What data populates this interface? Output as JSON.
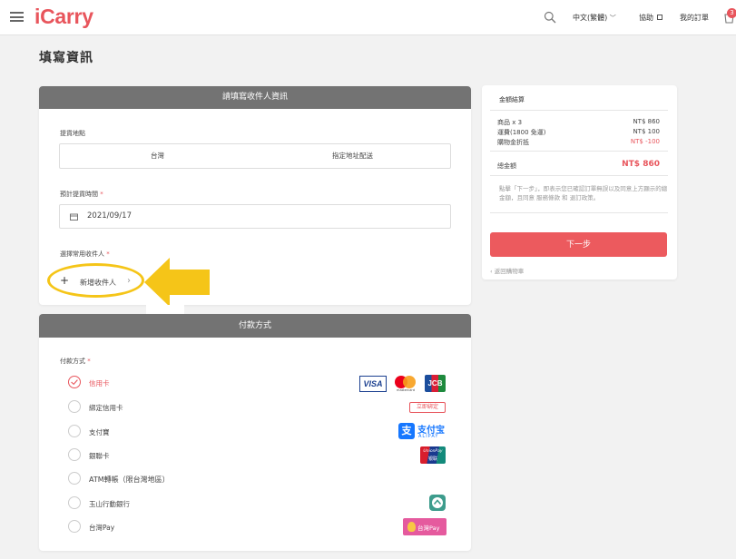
{
  "header": {
    "logo": "iCarry",
    "language": "中文(繁體)",
    "help": "協助",
    "orders": "我的訂單",
    "cart_count": "3"
  },
  "page_title": "填寫資訊",
  "recipient": {
    "header": "請填寫收件人資訊",
    "pickup_label": "提貨地點",
    "options": [
      "台灣",
      "指定地址配送"
    ],
    "date_label": "預計提貨時間",
    "date_value": "2021/09/17",
    "select_label": "選擇常用收件人",
    "add_recipient": "新增收件人",
    "required_mark": "*"
  },
  "payment": {
    "header": "付款方式",
    "label": "付款方式",
    "methods": [
      {
        "name": "信用卡",
        "selected": true
      },
      {
        "name": "綁定信用卡",
        "badge": "立即綁定"
      },
      {
        "name": "支付寶"
      },
      {
        "name": "銀聯卡"
      },
      {
        "name": "ATM轉帳（限台灣地區）"
      },
      {
        "name": "玉山行動銀行"
      },
      {
        "name": "台灣Pay"
      }
    ],
    "card_brands": [
      "VISA",
      "mastercard",
      "JCB"
    ],
    "alipay_text": "支付宝",
    "alipay_sub": "ALIPAY",
    "unionpay_text": "UnionPay",
    "unionpay_sub": "银联",
    "taiwanpay_text": "台灣Pay"
  },
  "summary": {
    "title": "金額結算",
    "rows": [
      {
        "label": "商品 x 3",
        "value": "NT$ 860"
      },
      {
        "label": "運費(1800 免運)",
        "value": "NT$ 100"
      },
      {
        "label": "購物金折抵",
        "value": "NT$ -100"
      }
    ],
    "total_label": "總金額",
    "total_value": "NT$ 860",
    "note": "點擊「下一步」，即表示您已確認訂單無誤以及同意上方顯示的總金額，且同意 服務條款 和 退訂政策。",
    "next_button": "下一步",
    "back_link": "返回購物車"
  },
  "colors": {
    "accent": "#e8555c",
    "header_bar": "#737373",
    "highlight": "#f5c518"
  }
}
